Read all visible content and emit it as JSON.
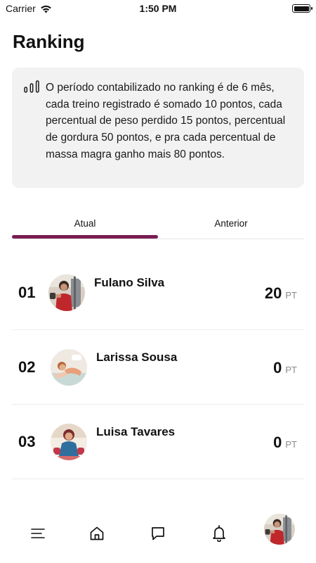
{
  "status_bar": {
    "carrier": "Carrier",
    "time": "1:50 PM",
    "icons": [
      "wifi-icon",
      "battery-icon"
    ]
  },
  "page": {
    "title": "Ranking"
  },
  "info": {
    "icon": "bar-chart-icon",
    "text": "O período contabilizado no ranking é de 6 mês, cada treino registrado é somado 10 pontos, cada percentual de peso perdido 15 pontos, percentual de gordura 50 pontos, e pra cada percentual de massa magra ganho mais 80 pontos."
  },
  "tabs": {
    "current": "Atual",
    "previous": "Anterior",
    "active": "current",
    "accent_color": "#7a1d52"
  },
  "ranking": [
    {
      "position": "01",
      "name": "Fulano Silva",
      "points": "20",
      "unit": "PT"
    },
    {
      "position": "02",
      "name": "Larissa Sousa",
      "points": "0",
      "unit": "PT"
    },
    {
      "position": "03",
      "name": "Luisa Tavares",
      "points": "0",
      "unit": "PT"
    }
  ],
  "bottom_nav": {
    "items": [
      "menu-icon",
      "home-icon",
      "chat-icon",
      "bell-icon",
      "profile-avatar"
    ]
  }
}
